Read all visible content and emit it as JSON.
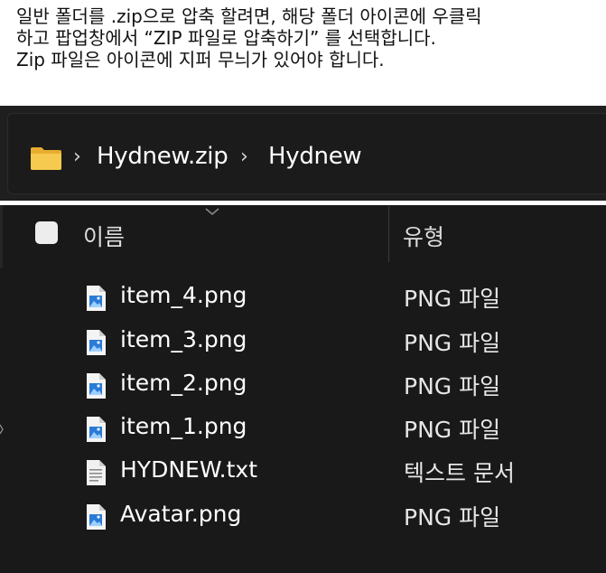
{
  "caption": {
    "line1": "일반 폴더를 .zip으로 압축 할려면, 해당 폴더 아이콘에 우클릭",
    "line2": "하고 팝업창에서 “ZIP 파일로 압축하기” 를 선택합니다.",
    "line3": "Zip 파일은 아이콘에 지퍼 무늬가 있어야 합니다."
  },
  "breadcrumb": {
    "icon": "folder-icon",
    "items": [
      "Hydnew.zip",
      "Hydnew"
    ]
  },
  "columns": {
    "name": "이름",
    "type": "유형"
  },
  "files": [
    {
      "name": "item_4.png",
      "type": "PNG 파일",
      "icon": "image-file-icon"
    },
    {
      "name": "item_3.png",
      "type": "PNG 파일",
      "icon": "image-file-icon"
    },
    {
      "name": "item_2.png",
      "type": "PNG 파일",
      "icon": "image-file-icon"
    },
    {
      "name": "item_1.png",
      "type": "PNG 파일",
      "icon": "image-file-icon"
    },
    {
      "name": "HYDNEW.txt",
      "type": "텍스트 문서",
      "icon": "text-file-icon"
    },
    {
      "name": "Avatar.png",
      "type": "PNG 파일",
      "icon": "image-file-icon"
    }
  ],
  "colors": {
    "background": "#191919",
    "text": "#ffffff",
    "folder": "#f2c14e",
    "image_accent": "#2a7bd6"
  }
}
